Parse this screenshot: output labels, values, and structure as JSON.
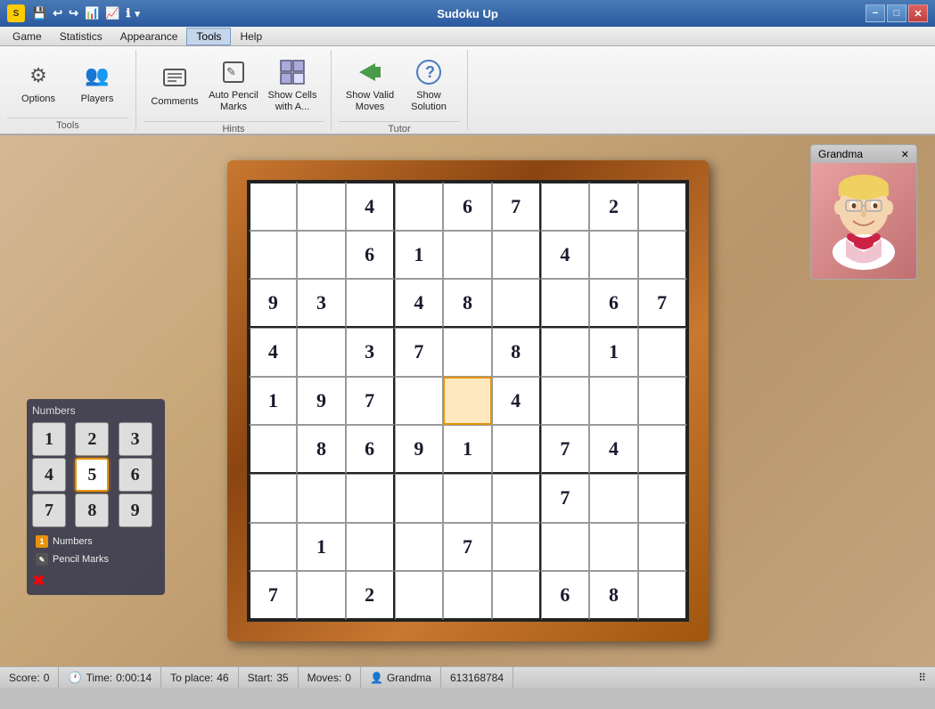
{
  "window": {
    "title": "Sudoku Up",
    "min_label": "−",
    "max_label": "□",
    "close_label": "✕"
  },
  "quickaccess": {
    "buttons": [
      "↩",
      "↪",
      "📊",
      "📈",
      "ℹ",
      "▾"
    ]
  },
  "menu": {
    "items": [
      "Game",
      "Statistics",
      "Appearance",
      "Tools",
      "Help"
    ],
    "active": "Tools"
  },
  "toolbar": {
    "groups": [
      {
        "label": "Tools",
        "items": [
          {
            "icon": "⚙",
            "label": "Options"
          },
          {
            "icon": "👥",
            "label": "Players"
          }
        ]
      },
      {
        "label": "Hints",
        "items": [
          {
            "icon": "📝",
            "label": "Comments"
          },
          {
            "icon": "✏",
            "label": "Auto Pencil\nMarks"
          },
          {
            "icon": "⊞",
            "label": "Show Cells\nwith A..."
          }
        ]
      },
      {
        "label": "Tutor",
        "items": [
          {
            "icon": "➡",
            "label": "Show Valid\nMoves"
          },
          {
            "icon": "?",
            "label": "Show\nSolution"
          }
        ]
      }
    ]
  },
  "board": {
    "cells": [
      [
        "",
        "",
        "4",
        "",
        "6",
        "7",
        "",
        "2",
        ""
      ],
      [
        "",
        "",
        "6",
        "1",
        "",
        "",
        "4",
        "",
        ""
      ],
      [
        "9",
        "3",
        "",
        "4",
        "8",
        "",
        "",
        "6",
        "7"
      ],
      [
        "4",
        "",
        "3",
        "7",
        "",
        "8",
        "",
        "1",
        ""
      ],
      [
        "1",
        "9",
        "7",
        "",
        "",
        "4",
        "",
        "",
        ""
      ],
      [
        "",
        "8",
        "6",
        "9",
        "1",
        "",
        "7",
        "4",
        ""
      ],
      [
        "",
        "",
        "",
        "",
        "",
        "",
        "7",
        "",
        ""
      ],
      [
        "",
        "1",
        "",
        "",
        "7",
        "",
        "",
        "",
        ""
      ],
      [
        "7",
        "",
        "2",
        "",
        "",
        "",
        "6",
        "8",
        ""
      ]
    ],
    "selected_row": 4,
    "selected_col": 4
  },
  "numbers_panel": {
    "title": "Numbers",
    "numbers": [
      "1",
      "2",
      "3",
      "4",
      "5",
      "6",
      "7",
      "8",
      "9"
    ],
    "active_number": "5",
    "mode_numbers_label": "Numbers",
    "mode_pencil_label": "Pencil Marks"
  },
  "player_panel": {
    "title": "Grandma",
    "close_label": "✕"
  },
  "status_bar": {
    "score_label": "Score:",
    "score_value": "0",
    "time_label": "Time:",
    "time_value": "0:00:14",
    "to_place_label": "To place:",
    "to_place_value": "46",
    "start_label": "Start:",
    "start_value": "35",
    "moves_label": "Moves:",
    "moves_value": "0",
    "player_icon": "👤",
    "player_name": "Grandma",
    "game_id": "613168784"
  }
}
